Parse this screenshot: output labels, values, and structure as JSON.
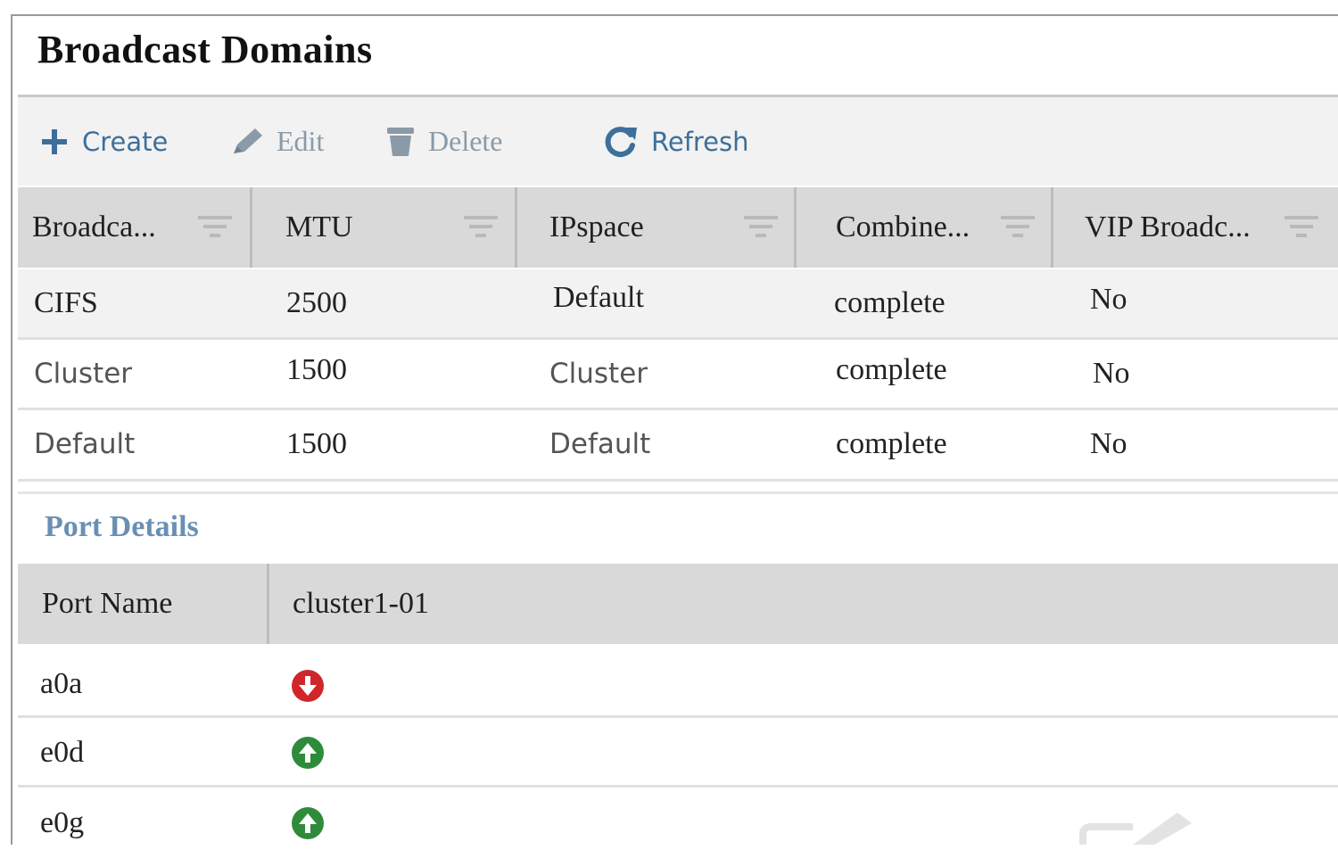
{
  "page": {
    "title": "Broadcast Domains"
  },
  "toolbar": {
    "create_label": "Create",
    "edit_label": "Edit",
    "delete_label": "Delete",
    "refresh_label": "Refresh",
    "icons": [
      "plus-icon",
      "pencil-icon",
      "trash-icon",
      "refresh-icon"
    ]
  },
  "table": {
    "columns": [
      "Broadca...",
      "MTU",
      "IPspace",
      "Combine...",
      "VIP Broadc..."
    ],
    "rows": [
      {
        "name": "CIFS",
        "mtu": "2500",
        "ipspace": "Default",
        "combined": "complete",
        "vip": "No"
      },
      {
        "name": "Cluster",
        "mtu": "1500",
        "ipspace": "Cluster",
        "combined": "complete",
        "vip": "No"
      },
      {
        "name": "Default",
        "mtu": "1500",
        "ipspace": "Default",
        "combined": "complete",
        "vip": "No"
      }
    ]
  },
  "port_details": {
    "title": "Port Details",
    "columns": [
      "Port Name",
      "cluster1-01"
    ],
    "rows": [
      {
        "port": "a0a",
        "status": "down"
      },
      {
        "port": "e0d",
        "status": "up"
      },
      {
        "port": "e0g",
        "status": "up"
      }
    ]
  },
  "colors": {
    "accent": "#3d6f9a",
    "status_up": "#2e8b3a",
    "status_down": "#d0262b",
    "header_bg": "#d9d9d9"
  }
}
